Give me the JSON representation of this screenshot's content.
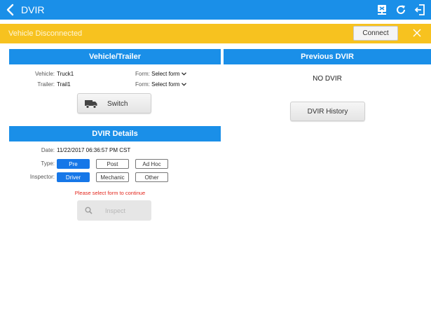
{
  "app": {
    "title": "DVIR"
  },
  "alert": {
    "message": "Vehicle Disconnected",
    "connect_label": "Connect"
  },
  "vehicle_trailer": {
    "header": "Vehicle/Trailer",
    "vehicle_label": "Vehicle:",
    "vehicle_value": "Truck1",
    "trailer_label": "Trailer:",
    "trailer_value": "Trail1",
    "form_label": "Form:",
    "form_placeholder": "Select form",
    "switch_label": "Switch"
  },
  "previous_dvir": {
    "header": "Previous DVIR",
    "empty_text": "NO DVIR",
    "history_label": "DVIR History"
  },
  "dvir_details": {
    "header": "DVIR Details",
    "date_label": "Date:",
    "date_value": "11/22/2017 06:36:57 PM CST",
    "type_label": "Type:",
    "type_options": [
      "Pre",
      "Post",
      "Ad Hoc"
    ],
    "type_selected": "Pre",
    "inspector_label": "Inspector:",
    "inspector_options": [
      "Driver",
      "Mechanic",
      "Other"
    ],
    "inspector_selected": "Driver",
    "warning": "Please select form to continue",
    "inspect_label": "Inspect"
  },
  "colors": {
    "primary": "#1a8fe8",
    "alert": "#f7c21f",
    "selected": "#1677e8",
    "warning": "#e3261c"
  },
  "icons": [
    "back-arrow-icon",
    "vehicle-device-icon",
    "refresh-icon",
    "logout-icon",
    "close-icon",
    "truck-icon",
    "search-icon",
    "chevron-down-icon"
  ]
}
